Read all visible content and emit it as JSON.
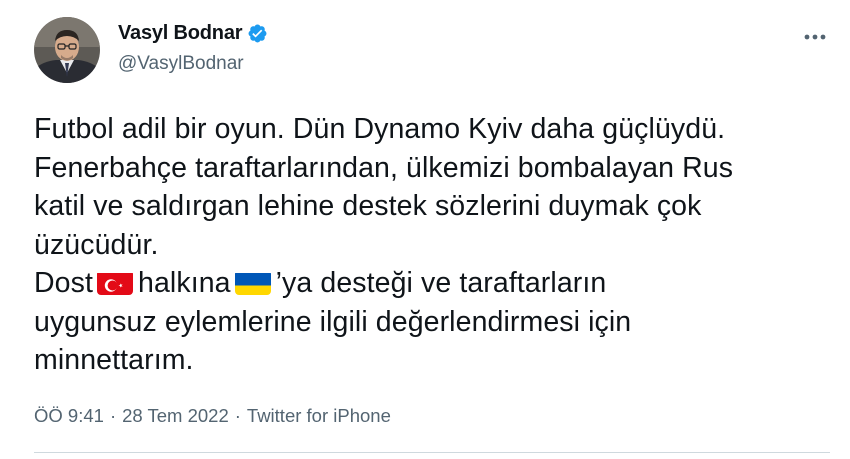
{
  "author": {
    "display_name": "Vasyl Bodnar",
    "handle": "@VasylBodnar",
    "verified": true,
    "avatar_icon": "profile-photo-man-glasses"
  },
  "tweet": {
    "line1": "Futbol adil bir oyun. Dün Dynamo Kyiv daha güçlüydü.",
    "line2": "Fenerbahçe taraftarlarından, ülkemizi bombalayan Rus",
    "line3": "katil ve saldırgan lehine destek sözlerini duymak çok",
    "line4": "üzücüdür.",
    "line5_a": "Dost",
    "line5_flag1": "turkey-flag-icon",
    "line5_b": "halkına",
    "line5_flag2": "ukraine-flag-icon",
    "line5_c": "’ya desteği ve taraftarların",
    "line6": "uygunsuz eylemlerine ilgili değerlendirmesi için",
    "line7": "minnettarım."
  },
  "meta": {
    "time": "ÖÖ 9:41",
    "separator1": "·",
    "date": "28 Tem 2022",
    "separator2": "·",
    "source": "Twitter for iPhone"
  },
  "colors": {
    "text": "#0f1419",
    "secondary": "#536471",
    "verified": "#1d9bf0",
    "turkey_red": "#e30a17",
    "ukraine_blue": "#0057b7",
    "ukraine_yellow": "#ffd700"
  }
}
